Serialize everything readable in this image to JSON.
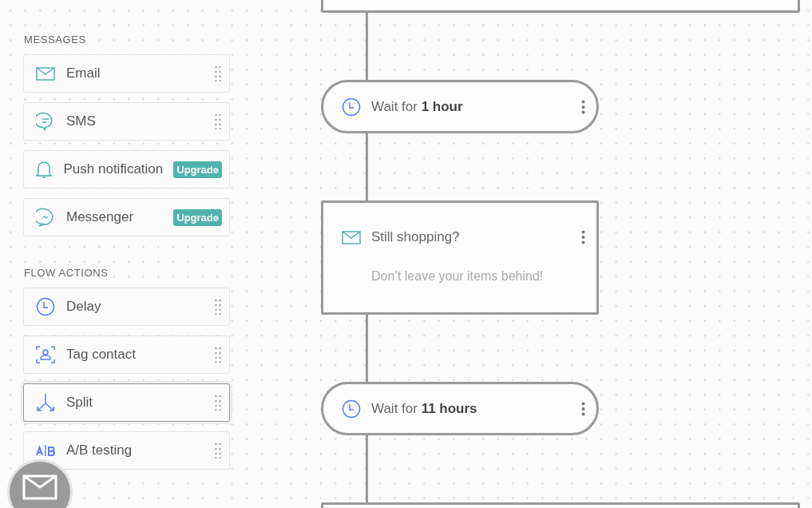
{
  "sidebar": {
    "sections": [
      {
        "title": "MESSAGES",
        "items": [
          {
            "label": "Email",
            "highlighted": false
          },
          {
            "label": "SMS",
            "highlighted": false
          },
          {
            "label": "Push notification",
            "badge": "Upgrade",
            "highlighted": false
          },
          {
            "label": "Messenger",
            "badge": "Upgrade",
            "highlighted": false
          }
        ]
      },
      {
        "title": "FLOW ACTIONS",
        "items": [
          {
            "label": "Delay",
            "highlighted": false
          },
          {
            "label": "Tag contact",
            "highlighted": false
          },
          {
            "label": "Split",
            "highlighted": true
          },
          {
            "label": "A/B testing",
            "highlighted": false
          }
        ]
      }
    ]
  },
  "flow": {
    "nodes": [
      {
        "kind": "cut"
      },
      {
        "kind": "delay",
        "text": "Wait for **1 hour**"
      },
      {
        "kind": "email",
        "title": "Still shopping?",
        "subtitle": "Don’t leave your items behind!"
      },
      {
        "kind": "delay",
        "text": "Wait for **11 hours**"
      },
      {
        "kind": "cut"
      }
    ]
  }
}
